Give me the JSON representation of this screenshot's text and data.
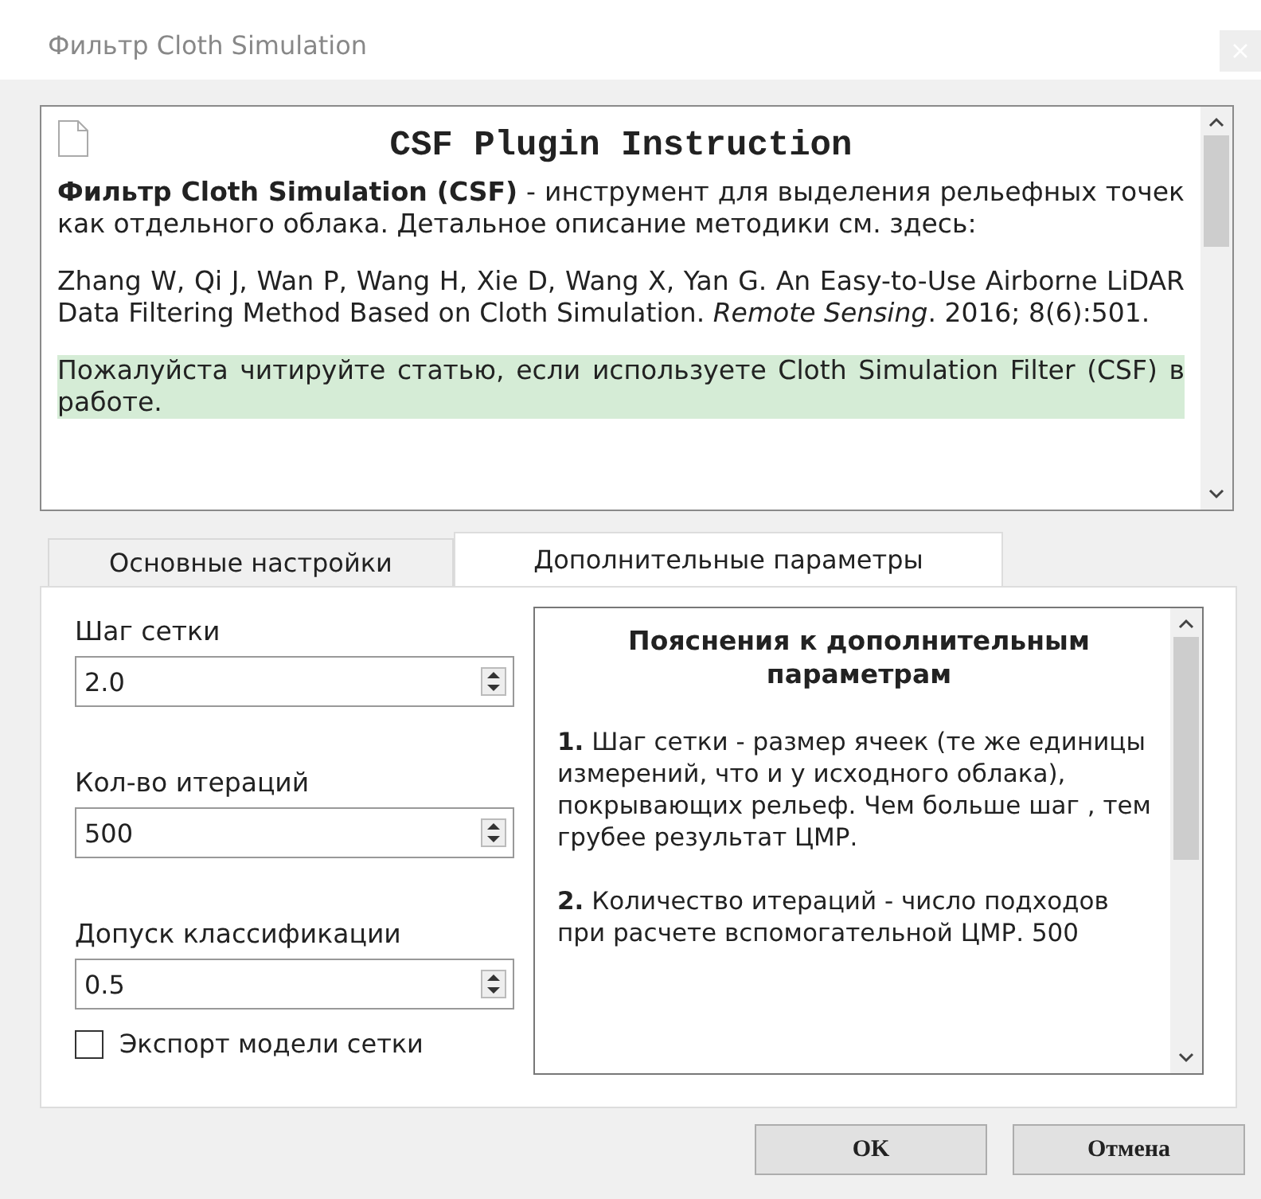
{
  "window": {
    "title": "Фильтр Cloth Simulation"
  },
  "instruction": {
    "title": "CSF Plugin Instruction",
    "paragraphs": [
      {
        "text": "**Фильтр Cloth Simulation (CSF)** - инструмент для выделения рельефных точек как отдельного облака. Детальное описание методики см. здесь:",
        "highlighted": false
      },
      {
        "text": "Zhang W, Qi J, Wan P, Wang H, Xie D, Wang X, Yan G. An Easy-to-Use Airborne LiDAR Data Filtering Method Based on Cloth Simulation. *Remote Sensing*. 2016; 8(6):501.",
        "highlighted": false
      },
      {
        "text": "Пожалуйста читируйте статью, если используете Cloth Simulation Filter (CSF) в работе.",
        "highlighted": true
      }
    ]
  },
  "tabs": [
    {
      "label": "Основные настройки",
      "selected": false
    },
    {
      "label": "Дополнительные параметры",
      "selected": true
    }
  ],
  "fields": [
    {
      "label": "Шаг сетки",
      "value": "2.0"
    },
    {
      "label": "Кол-во итераций",
      "value": "500"
    },
    {
      "label": "Допуск классификации",
      "value": "0.5"
    }
  ],
  "export_mesh": {
    "label": "Экспорт модели сетки",
    "checked": false
  },
  "help": {
    "title": "Пояснения к дополнительным параметрам",
    "paragraphs": [
      "**1.** Шаг сетки - размер ячеек (те же единицы измерений, что и у исходного облака), покрывающих рельеф. Чем больше шаг , тем грубее результат ЦМР.",
      "**2.** Количество итераций - число подходов при расчете вспомогательной ЦМР. 500"
    ]
  },
  "buttons": [
    "OK",
    "Отмена"
  ]
}
